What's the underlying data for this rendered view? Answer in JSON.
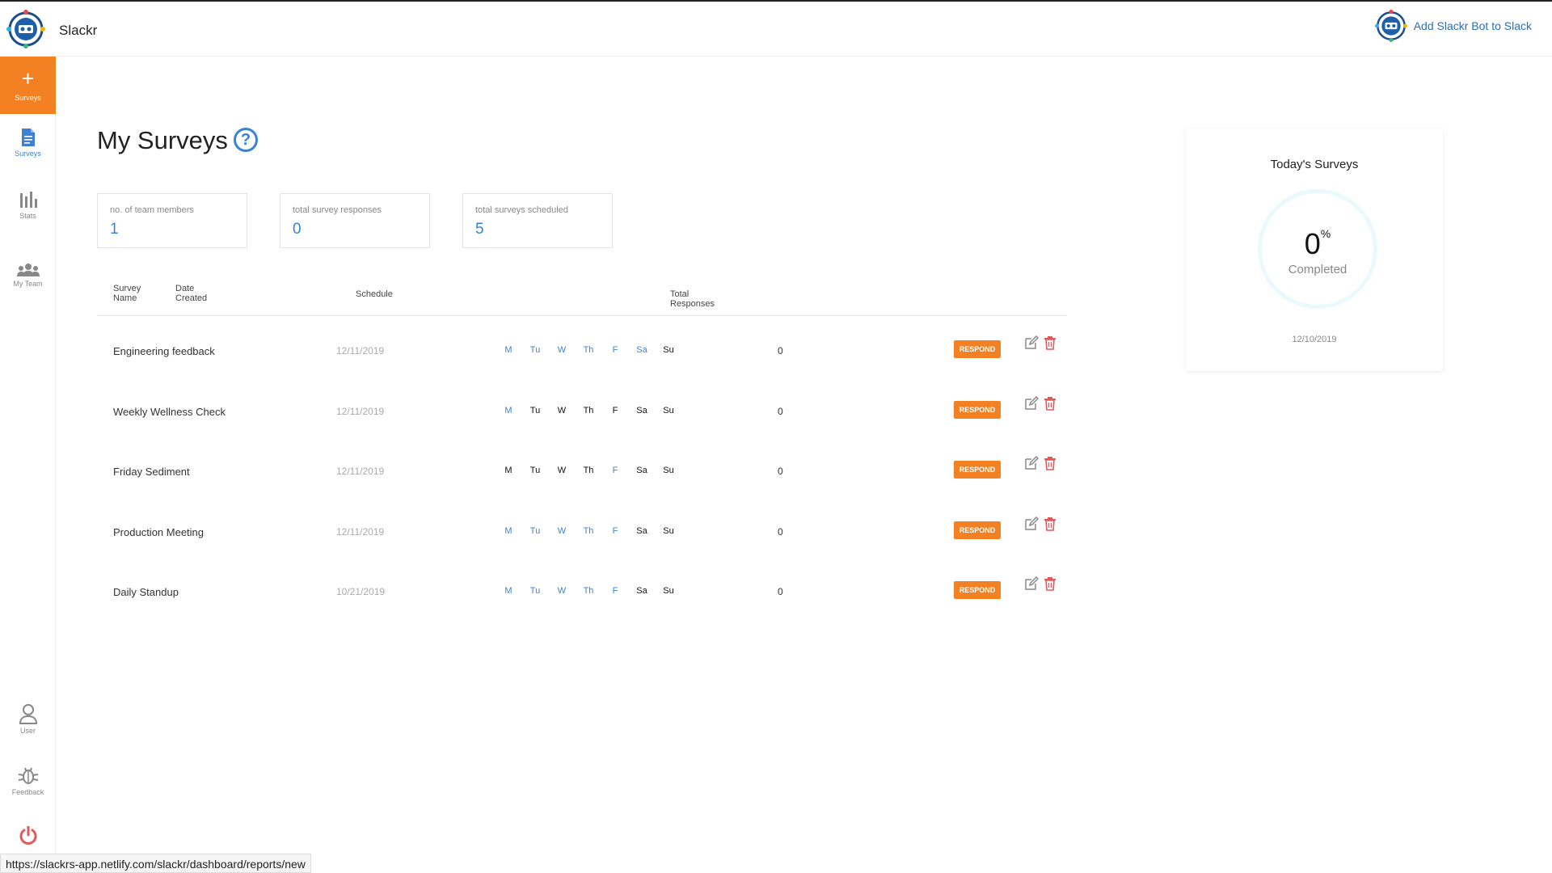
{
  "header": {
    "app_title": "Slackr",
    "add_bot_label": "Add Slackr Bot to Slack"
  },
  "sidebar": {
    "new_label": "Surveys",
    "items": [
      {
        "label": "Surveys",
        "icon": "document-icon"
      },
      {
        "label": "Stats",
        "icon": "bar-chart-icon"
      },
      {
        "label": "My Team",
        "icon": "team-icon"
      }
    ],
    "bottom": [
      {
        "label": "User",
        "icon": "user-icon"
      },
      {
        "label": "Feedback",
        "icon": "bug-icon"
      }
    ]
  },
  "main": {
    "title": "My Surveys",
    "help": "?",
    "stats": [
      {
        "label": "no. of team members",
        "value": "1"
      },
      {
        "label": "total survey responses",
        "value": "0"
      },
      {
        "label": "total surveys scheduled",
        "value": "5"
      }
    ],
    "columns": {
      "name_1": "Survey",
      "name_2": "Name",
      "date_1": "Date",
      "date_2": "Created",
      "schedule": "Schedule",
      "responses": "Total Responses"
    },
    "day_labels": [
      "M",
      "Tu",
      "W",
      "Th",
      "F",
      "Sa",
      "Su"
    ],
    "respond_label": "RESPOND",
    "rows": [
      {
        "name": "Engineering feedback",
        "date": "12/11/2019",
        "days": [
          1,
          1,
          1,
          1,
          1,
          1,
          0
        ],
        "responses": "0"
      },
      {
        "name": "Weekly Wellness Check",
        "date": "12/11/2019",
        "days": [
          1,
          0,
          0,
          0,
          0,
          0,
          0
        ],
        "responses": "0"
      },
      {
        "name": "Friday Sediment",
        "date": "12/11/2019",
        "days": [
          0,
          0,
          0,
          0,
          1,
          0,
          0
        ],
        "responses": "0"
      },
      {
        "name": "Production Meeting",
        "date": "12/11/2019",
        "days": [
          1,
          1,
          1,
          1,
          1,
          0,
          0
        ],
        "responses": "0"
      },
      {
        "name": "Daily Standup",
        "date": "10/21/2019",
        "days": [
          1,
          1,
          1,
          1,
          1,
          0,
          0
        ],
        "responses": "0"
      }
    ]
  },
  "today": {
    "title": "Today's Surveys",
    "percent": "0",
    "percent_sign": "%",
    "completed": "Completed",
    "date": "12/10/2019"
  },
  "status_url": "https://slackrs-app.netlify.com/slackr/dashboard/reports/new",
  "colors": {
    "accent": "#f48024",
    "blue": "#3b82d6",
    "delete": "#e05a5a",
    "ring": "#eafafc"
  }
}
